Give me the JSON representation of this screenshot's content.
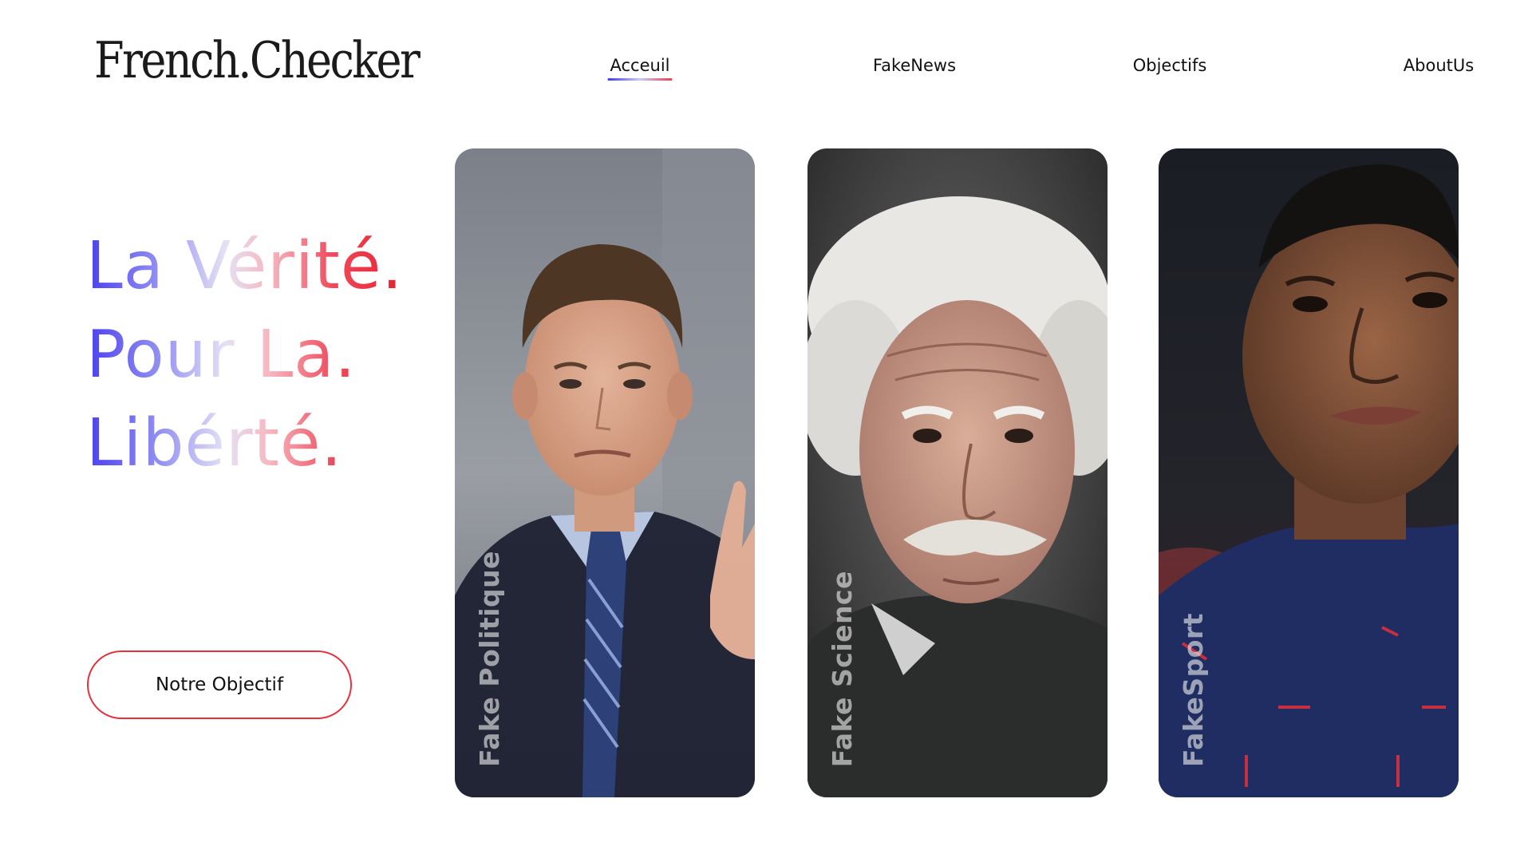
{
  "header": {
    "logo": "French.Checker",
    "nav": [
      {
        "label": "Acceuil",
        "active": true
      },
      {
        "label": "FakeNews",
        "active": false
      },
      {
        "label": "Objectifs",
        "active": false
      },
      {
        "label": "AboutUs",
        "active": false
      }
    ]
  },
  "hero": {
    "lines": [
      "La Vérité.",
      "Pour La.",
      "Libérté."
    ],
    "cta_label": "Notre Objectif"
  },
  "cards": [
    {
      "label": "Fake Politique",
      "photo": "portrait of a politician in suit and tie, waving"
    },
    {
      "label": "Fake Science",
      "photo": "portrait of an elderly scientist with white hair and moustache"
    },
    {
      "label": "FakeSport",
      "photo": "portrait of a footballer in a navy club jersey"
    }
  ],
  "colors": {
    "accent_blue": "#3b3bf5",
    "accent_red": "#e8303d",
    "text": "#111111",
    "background": "#ffffff"
  }
}
